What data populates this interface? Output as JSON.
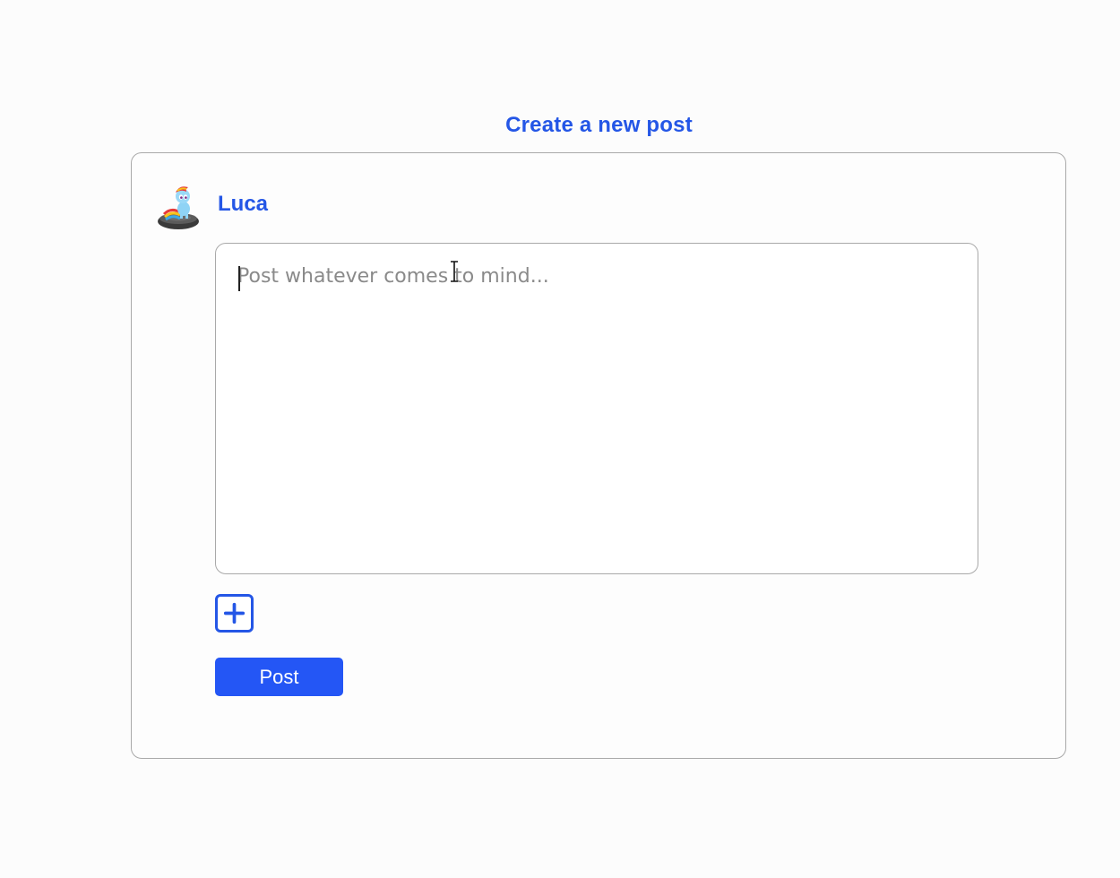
{
  "page": {
    "title": "Create a new post"
  },
  "author": {
    "name": "Luca"
  },
  "composer": {
    "value": "",
    "placeholder": "Post whatever comes to mind..."
  },
  "actions": {
    "add_media_icon": "plus-square-icon",
    "post_label": "Post"
  },
  "colors": {
    "accent": "#2456e6",
    "button": "#2456f5",
    "border": "#a9a9a9"
  }
}
